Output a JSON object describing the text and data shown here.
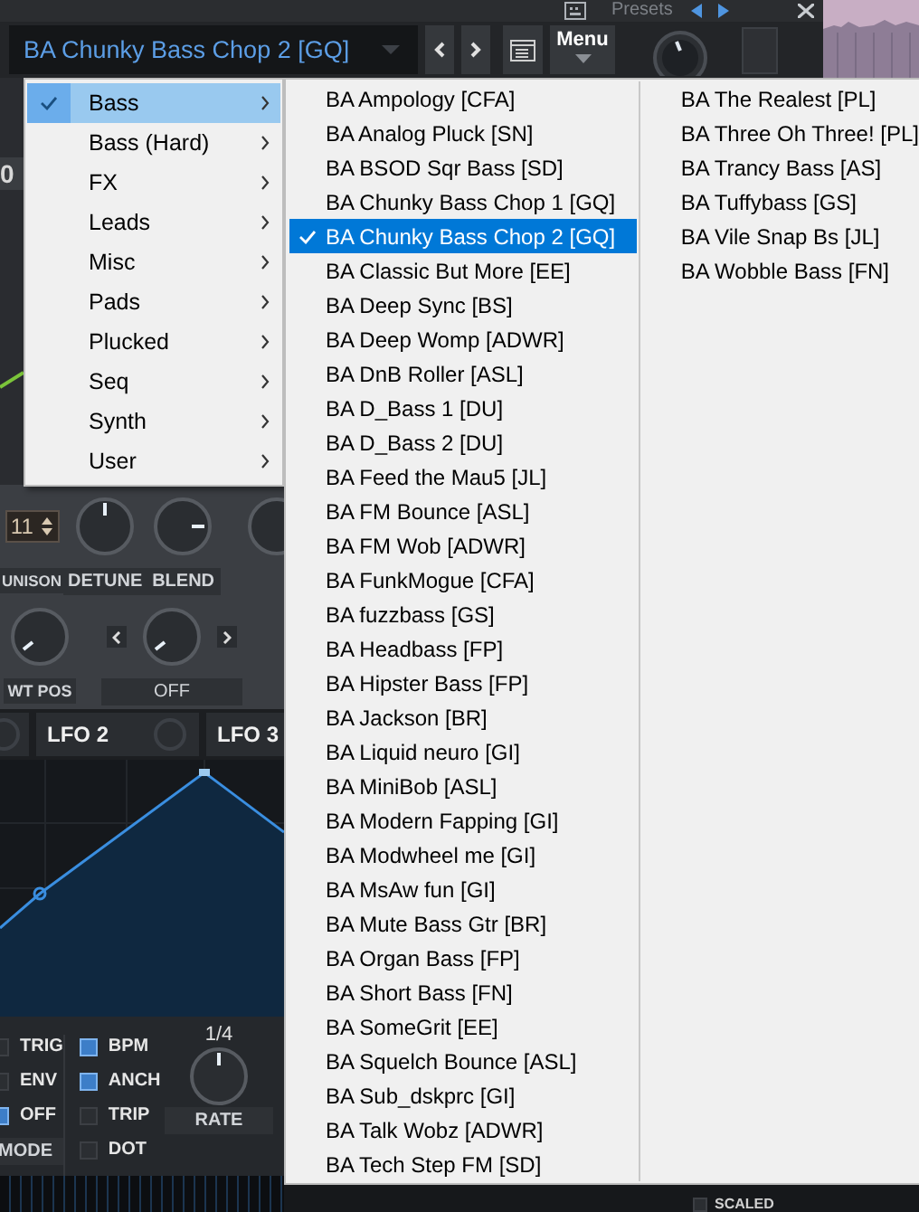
{
  "top_bar": {
    "presets_label": "Presets"
  },
  "preset_bar": {
    "preset_name": "BA Chunky Bass Chop 2 [GQ]",
    "menu_label": "Menu"
  },
  "side_value": "0",
  "osc": {
    "unison_value": "11",
    "row1_labels": [
      "UNISON",
      "DETUNE",
      "BLEND"
    ],
    "row2_labels": [
      "WT POS",
      "OFF"
    ]
  },
  "lfo_tabs": [
    {
      "label": "LFO 2"
    },
    {
      "label": "LFO 3"
    }
  ],
  "lfo_mode": [
    {
      "label": "TRIG",
      "checked": false
    },
    {
      "label": "ENV",
      "checked": false
    },
    {
      "label": "OFF",
      "checked": true
    }
  ],
  "mode_label": "MODE",
  "lfo_options": [
    {
      "label": "BPM",
      "checked": true
    },
    {
      "label": "ANCH",
      "checked": true
    },
    {
      "label": "TRIP",
      "checked": false
    },
    {
      "label": "DOT",
      "checked": false
    }
  ],
  "rate": {
    "value": "1/4",
    "label": "RATE"
  },
  "scaled": {
    "label": "SCALED",
    "checked": false
  },
  "category_menu": [
    {
      "label": "Bass",
      "selected": true
    },
    {
      "label": "Bass (Hard)",
      "selected": false
    },
    {
      "label": "FX",
      "selected": false
    },
    {
      "label": "Leads",
      "selected": false
    },
    {
      "label": "Misc",
      "selected": false
    },
    {
      "label": "Pads",
      "selected": false
    },
    {
      "label": "Plucked",
      "selected": false
    },
    {
      "label": "Seq",
      "selected": false
    },
    {
      "label": "Synth",
      "selected": false
    },
    {
      "label": "User",
      "selected": false
    }
  ],
  "preset_menu": [
    [
      {
        "label": "BA Ampology [CFA]",
        "selected": false
      },
      {
        "label": "BA Analog Pluck [SN]",
        "selected": false
      },
      {
        "label": "BA BSOD Sqr Bass [SD]",
        "selected": false
      },
      {
        "label": "BA Chunky Bass Chop 1 [GQ]",
        "selected": false
      },
      {
        "label": "BA Chunky Bass Chop 2 [GQ]",
        "selected": true
      },
      {
        "label": "BA Classic But More [EE]",
        "selected": false
      },
      {
        "label": "BA Deep Sync [BS]",
        "selected": false
      },
      {
        "label": "BA Deep Womp [ADWR]",
        "selected": false
      },
      {
        "label": "BA DnB Roller [ASL]",
        "selected": false
      },
      {
        "label": "BA D_Bass 1 [DU]",
        "selected": false
      },
      {
        "label": "BA D_Bass 2 [DU]",
        "selected": false
      },
      {
        "label": "BA Feed the Mau5 [JL]",
        "selected": false
      },
      {
        "label": "BA FM Bounce [ASL]",
        "selected": false
      },
      {
        "label": "BA FM Wob [ADWR]",
        "selected": false
      },
      {
        "label": "BA FunkMogue [CFA]",
        "selected": false
      },
      {
        "label": "BA fuzzbass [GS]",
        "selected": false
      },
      {
        "label": "BA Headbass [FP]",
        "selected": false
      },
      {
        "label": "BA Hipster Bass [FP]",
        "selected": false
      },
      {
        "label": "BA Jackson [BR]",
        "selected": false
      },
      {
        "label": "BA Liquid neuro [GI]",
        "selected": false
      },
      {
        "label": "BA MiniBob [ASL]",
        "selected": false
      },
      {
        "label": "BA Modern Fapping [GI]",
        "selected": false
      },
      {
        "label": "BA Modwheel me [GI]",
        "selected": false
      },
      {
        "label": "BA MsAw fun [GI]",
        "selected": false
      },
      {
        "label": "BA Mute Bass Gtr [BR]",
        "selected": false
      },
      {
        "label": "BA Organ Bass [FP]",
        "selected": false
      },
      {
        "label": "BA Short Bass [FN]",
        "selected": false
      },
      {
        "label": "BA SomeGrit [EE]",
        "selected": false
      },
      {
        "label": "BA Squelch Bounce [ASL]",
        "selected": false
      },
      {
        "label": "BA Sub_dskprc [GI]",
        "selected": false
      },
      {
        "label": "BA Talk Wobz [ADWR]",
        "selected": false
      },
      {
        "label": "BA Tech Step FM [SD]",
        "selected": false
      }
    ],
    [
      {
        "label": "BA The Realest [PL]",
        "selected": false
      },
      {
        "label": "BA Three Oh Three! [PL]",
        "selected": false
      },
      {
        "label": "BA Trancy Bass [AS]",
        "selected": false
      },
      {
        "label": "BA Tuffybass [GS]",
        "selected": false
      },
      {
        "label": "BA Vile Snap Bs [JL]",
        "selected": false
      },
      {
        "label": "BA Wobble Bass [FN]",
        "selected": false
      }
    ]
  ]
}
